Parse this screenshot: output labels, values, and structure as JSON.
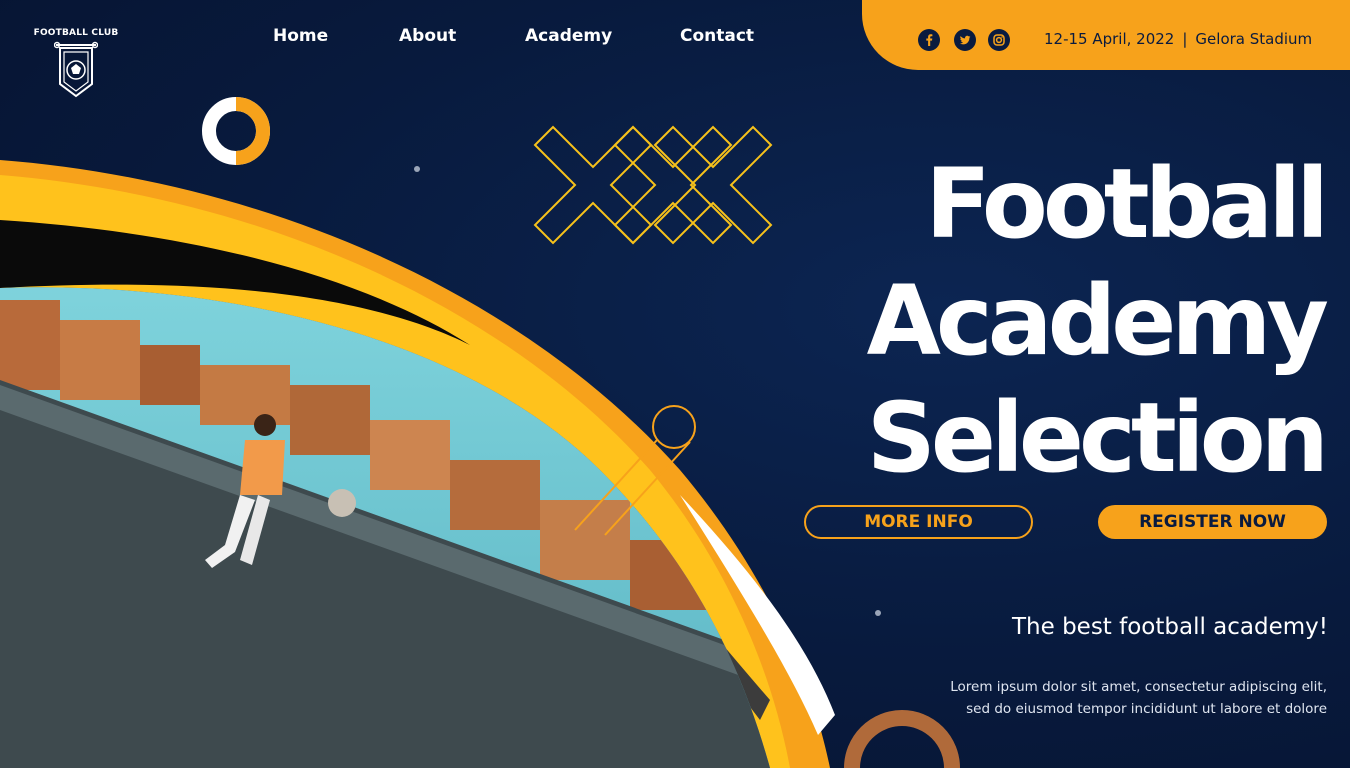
{
  "logo": {
    "text": "FOOTBALL CLUB"
  },
  "nav": {
    "items": [
      "Home",
      "About",
      "Academy",
      "Contact"
    ]
  },
  "social": {
    "icons": [
      "facebook-icon",
      "twitter-icon",
      "instagram-icon"
    ]
  },
  "event": {
    "date": "12-15 April, 2022",
    "separator": "|",
    "venue": "Gelora Stadium"
  },
  "hero": {
    "title_lines": [
      "Football",
      "Academy",
      "Selection"
    ]
  },
  "buttons": {
    "more_info": "MORE INFO",
    "register": "REGISTER NOW"
  },
  "tagline": "The best football academy!",
  "description": {
    "line1": "Lorem ipsum dolor sit amet, consectetur  adipiscing elit,",
    "line2": "sed do eiusmod tempor incididunt ut labore et dolore"
  },
  "colors": {
    "accent": "#f7a21b",
    "background": "#081a3d",
    "text": "#ffffff"
  }
}
